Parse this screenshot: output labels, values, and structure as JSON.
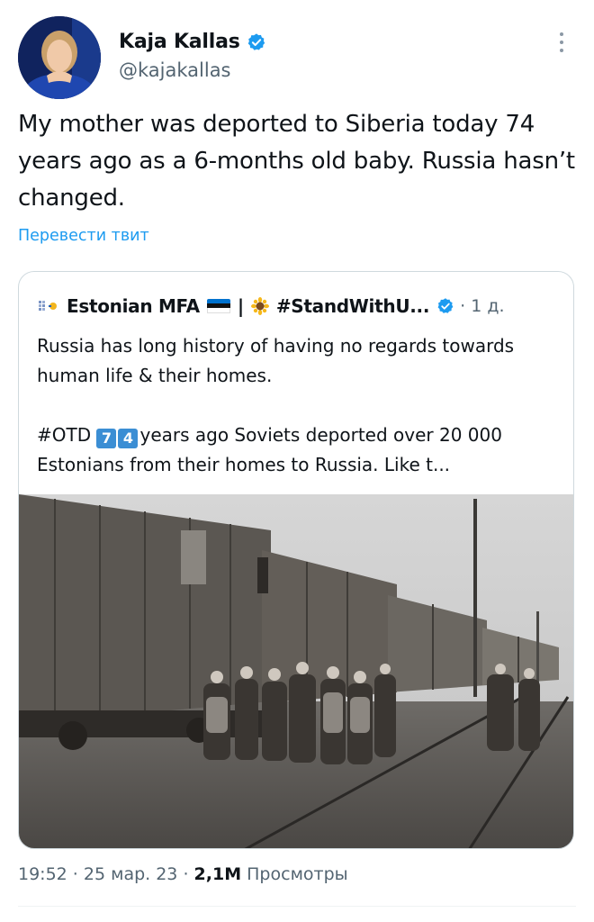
{
  "author": {
    "name": "Kaja Kallas",
    "handle": "@kajakallas"
  },
  "tweet": {
    "text": "My mother was deported to Siberia today 74 years ago as a 6-months old baby. Russia hasn’t changed.",
    "translate_label": "Перевести твит"
  },
  "quote": {
    "author_name": "Estonian MFA",
    "separator": "|",
    "hashtag_name": "#StandWithU...",
    "dot": "·",
    "time": "1 д.",
    "paragraph1": "Russia has long history of having no regards towards human life & their homes.",
    "hashtag": "#OTD",
    "keycap1": "7",
    "keycap2": "4",
    "paragraph2_rest": "years ago Soviets deported over 20 000 Estonians from their homes to Russia. Like t..."
  },
  "meta": {
    "time": "19:52",
    "sep1": " · ",
    "date": "25 мар. 23",
    "sep2": " · ",
    "views_count": "2,1M",
    "views_label": " Просмотры"
  },
  "colors": {
    "link": "#1d9bf0",
    "verified": "#1d9bf0",
    "secondary_text": "#536471",
    "border": "#cfd9de"
  }
}
